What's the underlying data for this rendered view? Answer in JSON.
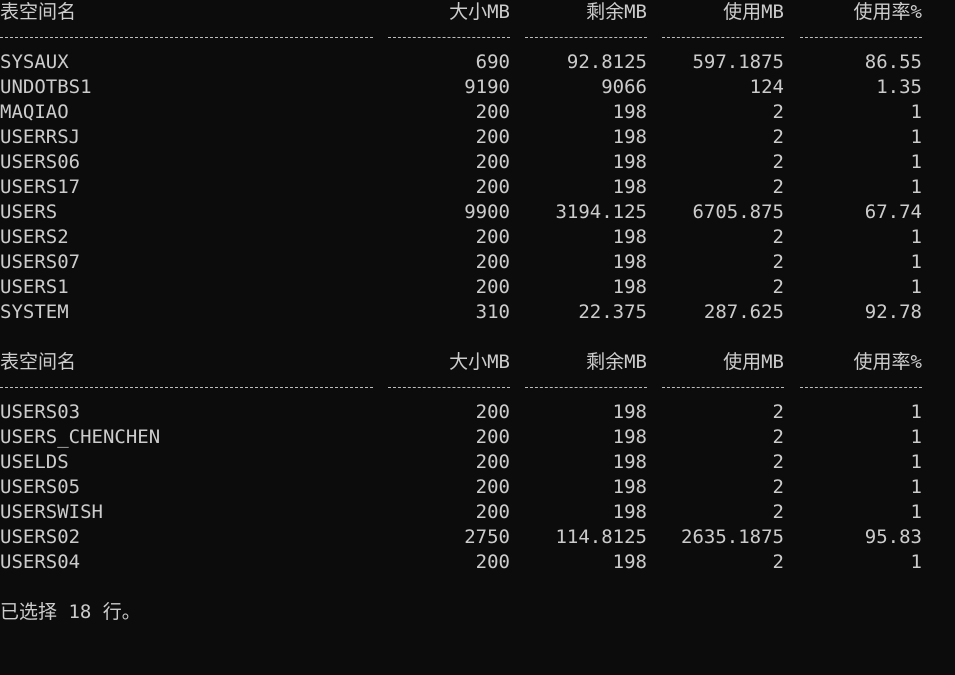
{
  "headers": [
    "表空间名",
    "大小MB",
    "剩余MB",
    "使用MB",
    "使用率%"
  ],
  "block1": [
    [
      "SYSAUX",
      "690",
      "92.8125",
      "597.1875",
      "86.55"
    ],
    [
      "UNDOTBS1",
      "9190",
      "9066",
      "124",
      "1.35"
    ],
    [
      "MAQIAO",
      "200",
      "198",
      "2",
      "1"
    ],
    [
      "USERRSJ",
      "200",
      "198",
      "2",
      "1"
    ],
    [
      "USERS06",
      "200",
      "198",
      "2",
      "1"
    ],
    [
      "USERS17",
      "200",
      "198",
      "2",
      "1"
    ],
    [
      "USERS",
      "9900",
      "3194.125",
      "6705.875",
      "67.74"
    ],
    [
      "USERS2",
      "200",
      "198",
      "2",
      "1"
    ],
    [
      "USERS07",
      "200",
      "198",
      "2",
      "1"
    ],
    [
      "USERS1",
      "200",
      "198",
      "2",
      "1"
    ],
    [
      "SYSTEM",
      "310",
      "22.375",
      "287.625",
      "92.78"
    ]
  ],
  "block2": [
    [
      "USERS03",
      "200",
      "198",
      "2",
      "1"
    ],
    [
      "USERS_CHENCHEN",
      "200",
      "198",
      "2",
      "1"
    ],
    [
      "USELDS",
      "200",
      "198",
      "2",
      "1"
    ],
    [
      "USERS05",
      "200",
      "198",
      "2",
      "1"
    ],
    [
      "USERSWISH",
      "200",
      "198",
      "2",
      "1"
    ],
    [
      "USERS02",
      "2750",
      "114.8125",
      "2635.1875",
      "95.83"
    ],
    [
      "USERS04",
      "200",
      "198",
      "2",
      "1"
    ]
  ],
  "footer": "已选择 18 行。"
}
